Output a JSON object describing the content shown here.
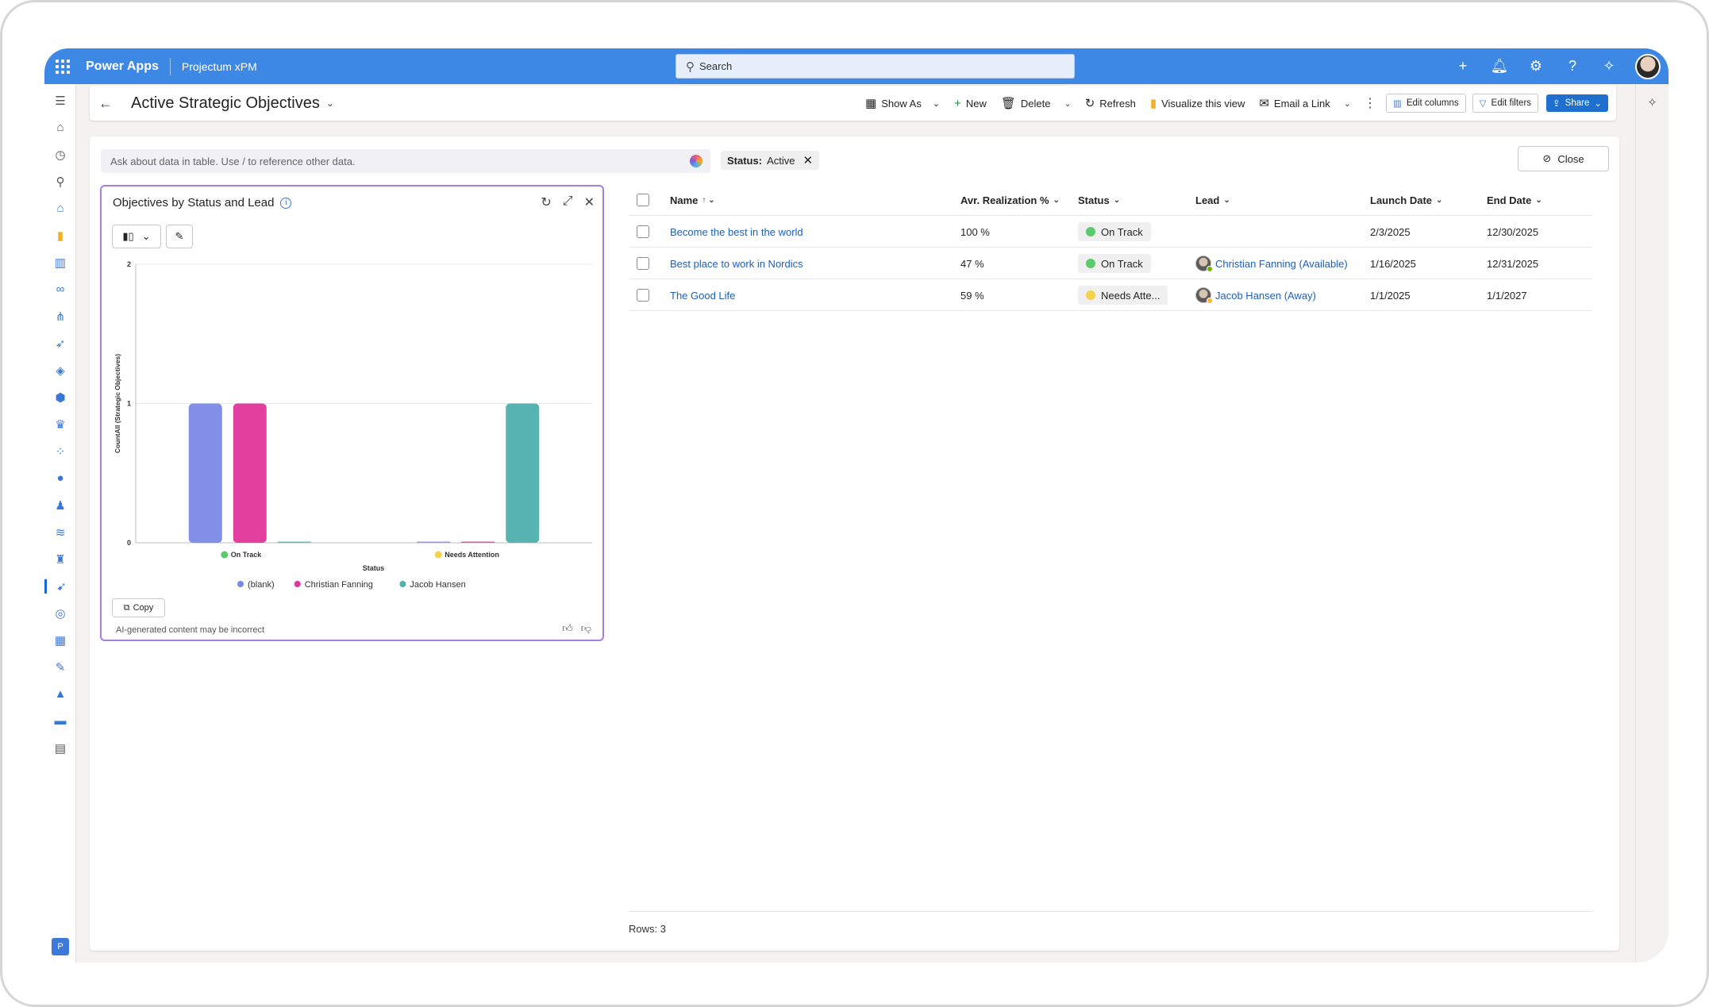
{
  "topbar": {
    "brand": "Power Apps",
    "app_name": "Projectum xPM",
    "search_placeholder": "Search"
  },
  "command_bar": {
    "page_title": "Active Strategic Objectives",
    "show_as": "Show As",
    "new": "New",
    "delete": "Delete",
    "refresh": "Refresh",
    "visualize": "Visualize this view",
    "email_link": "Email a Link",
    "edit_columns": "Edit columns",
    "edit_filters": "Edit filters",
    "share": "Share"
  },
  "ask_bar": {
    "placeholder": "Ask about data in table. Use / to reference other data."
  },
  "filter_chip": {
    "label": "Status:",
    "value": "Active"
  },
  "close_button": "Close",
  "chart_card": {
    "title": "Objectives by Status and Lead",
    "copy": "Copy",
    "disclaimer": "AI-generated content may be incorrect"
  },
  "chart_data": {
    "type": "bar",
    "title": "Objectives by Status and Lead",
    "xlabel": "Status",
    "ylabel": "CountAll (Strategic Objectives)",
    "categories": [
      "On Track",
      "Needs Attention"
    ],
    "category_colors": [
      "#5cc96b",
      "#f5d24b"
    ],
    "ylim": [
      0,
      2
    ],
    "yticks": [
      "0",
      "1",
      "2"
    ],
    "grid": true,
    "legend_position": "bottom",
    "series": [
      {
        "name": "(blank)",
        "color": "#7b89e6",
        "values": [
          1,
          0
        ]
      },
      {
        "name": "Christian Fanning",
        "color": "#e0359a",
        "values": [
          1,
          0
        ]
      },
      {
        "name": "Jacob Hansen",
        "color": "#4fb0ae",
        "values": [
          0,
          1
        ]
      }
    ]
  },
  "grid": {
    "columns": [
      "Name",
      "Avr. Realization %",
      "Status",
      "Lead",
      "Launch Date",
      "End Date"
    ],
    "rows": [
      {
        "name": "Become the best in the world",
        "realization": "100 %",
        "status": "On Track",
        "status_color": "#5cc96b",
        "lead": "",
        "lead_status_color": "",
        "launch": "2/3/2025",
        "end": "12/30/2025"
      },
      {
        "name": "Best place to work in Nordics",
        "realization": "47 %",
        "status": "On Track",
        "status_color": "#5cc96b",
        "lead": "Christian Fanning (Available)",
        "lead_status_color": "#6bb700",
        "launch": "1/16/2025",
        "end": "12/31/2025"
      },
      {
        "name": "The Good Life",
        "realization": "59 %",
        "status": "Needs Atte...",
        "status_color": "#f5d24b",
        "lead": "Jacob Hansen (Away)",
        "lead_status_color": "#f8b73b",
        "launch": "1/1/2025",
        "end": "1/1/2027"
      }
    ]
  },
  "footer": {
    "rows_label": "Rows: 3"
  },
  "colors": {
    "topbar": "#3e88e5",
    "accent": "#1f6fcf",
    "card_border": "#a37fe0"
  }
}
